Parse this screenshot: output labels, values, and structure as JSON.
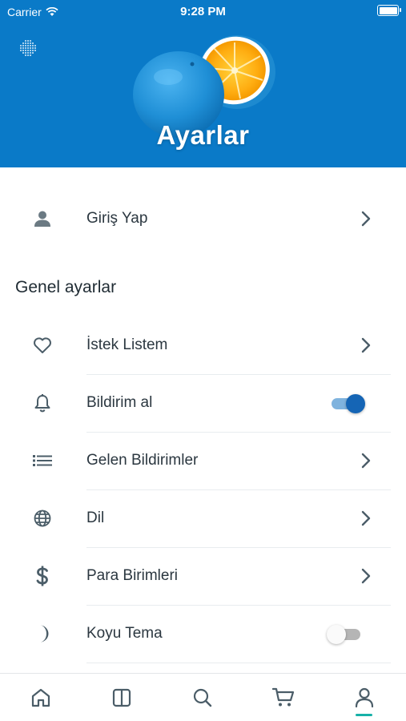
{
  "status_bar": {
    "carrier": "Carrier",
    "time": "9:28 PM"
  },
  "header": {
    "title": "Ayarlar"
  },
  "login": {
    "label": "Giriş Yap"
  },
  "general": {
    "section_title": "Genel ayarlar",
    "items": [
      {
        "label": "İstek Listem",
        "icon": "heart-icon",
        "control": "chevron"
      },
      {
        "label": "Bildirim al",
        "icon": "bell-icon",
        "control": "toggle",
        "enabled": true
      },
      {
        "label": "Gelen Bildirimler",
        "icon": "list-icon",
        "control": "chevron"
      },
      {
        "label": "Dil",
        "icon": "globe-icon",
        "control": "chevron"
      },
      {
        "label": "Para Birimleri",
        "icon": "dollar-icon",
        "control": "chevron"
      },
      {
        "label": "Koyu Tema",
        "icon": "moon-icon",
        "control": "toggle",
        "enabled": false
      }
    ]
  },
  "tabbar": {
    "tabs": [
      {
        "icon": "home-icon",
        "active": false
      },
      {
        "icon": "columns-icon",
        "active": false
      },
      {
        "icon": "search-icon",
        "active": false
      },
      {
        "icon": "cart-icon",
        "active": false
      },
      {
        "icon": "user-icon",
        "active": true
      }
    ]
  },
  "colors": {
    "header_bg": "#0a7ac8",
    "accent": "#1565b5",
    "tab_active": "#17b1a8",
    "icon": "#4b5d68"
  }
}
